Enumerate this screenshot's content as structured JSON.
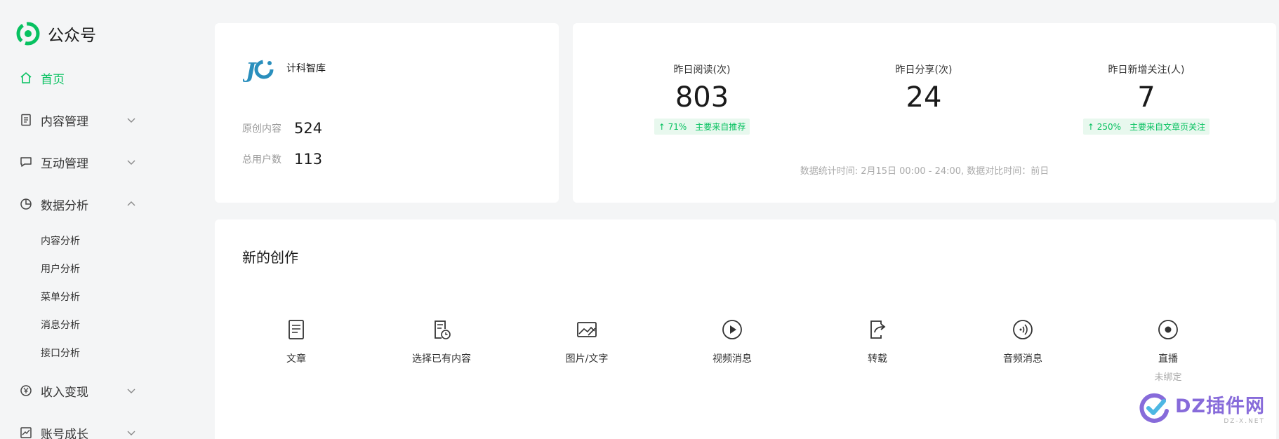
{
  "brand": {
    "title": "公众号",
    "accent": "#07c160"
  },
  "sidebar": {
    "items": [
      {
        "label": "首页",
        "icon": "home-icon",
        "active": true
      },
      {
        "label": "内容管理",
        "icon": "document-icon",
        "expandable": true
      },
      {
        "label": "互动管理",
        "icon": "chat-icon",
        "expandable": true
      },
      {
        "label": "数据分析",
        "icon": "pie-chart-icon",
        "expandable": true,
        "expanded": true
      },
      {
        "label": "收入变现",
        "icon": "yen-icon",
        "expandable": true
      },
      {
        "label": "账号成长",
        "icon": "trend-icon",
        "expandable": true
      }
    ],
    "sub_items": [
      "内容分析",
      "用户分析",
      "菜单分析",
      "消息分析",
      "接口分析"
    ]
  },
  "account": {
    "name": "计科智库",
    "rows": [
      {
        "label": "原创内容",
        "value": "524"
      },
      {
        "label": "总用户数",
        "value": "113"
      }
    ]
  },
  "stats": {
    "items": [
      {
        "label": "昨日阅读(次)",
        "value": "803",
        "trend": "↑ 71%",
        "trend_note": "主要来自推荐"
      },
      {
        "label": "昨日分享(次)",
        "value": "24"
      },
      {
        "label": "昨日新增关注(人)",
        "value": "7",
        "trend": "↑ 250%",
        "trend_note": "主要来自文章页关注"
      }
    ],
    "note": "数据统计时间: 2月15日 00:00 - 24:00, 数据对比时间：前日"
  },
  "create": {
    "title": "新的创作",
    "items": [
      {
        "label": "文章",
        "icon": "article-icon"
      },
      {
        "label": "选择已有内容",
        "icon": "existing-content-icon"
      },
      {
        "label": "图片/文字",
        "icon": "image-icon"
      },
      {
        "label": "视频消息",
        "icon": "video-play-icon"
      },
      {
        "label": "转载",
        "icon": "repost-icon"
      },
      {
        "label": "音频消息",
        "icon": "audio-icon"
      },
      {
        "label": "直播",
        "icon": "live-icon",
        "sub": "未绑定"
      }
    ]
  },
  "watermark": {
    "main": "DZ插件网",
    "sub": "DZ-X.NET"
  }
}
